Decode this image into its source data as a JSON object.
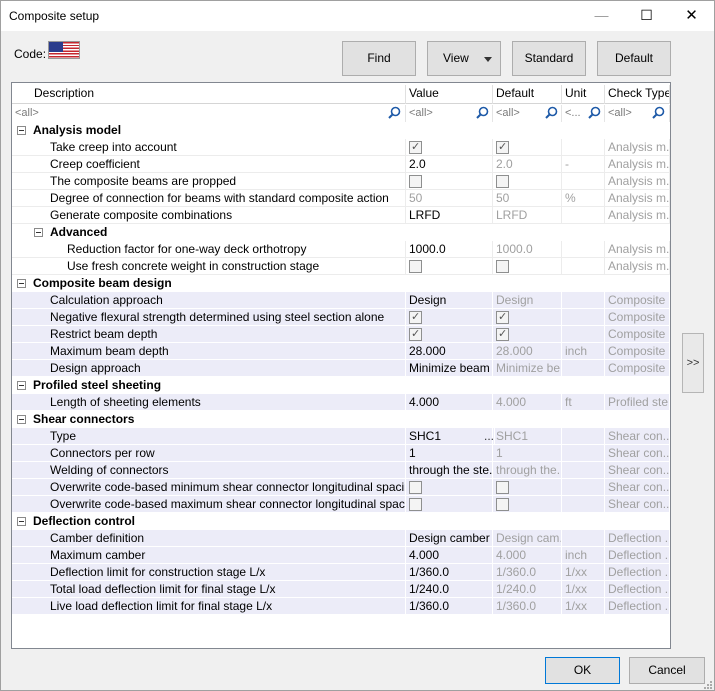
{
  "window": {
    "title": "Composite setup",
    "minimize": "—",
    "maximize": "☐",
    "close": "✕"
  },
  "code": {
    "label": "Code:",
    "flag_icon": "us-flag-icon"
  },
  "toolbar": {
    "find": "Find",
    "view": "View",
    "standard": "Standard",
    "default": "Default"
  },
  "columns": {
    "description": "Description",
    "value": "Value",
    "default": "Default",
    "unit": "Unit",
    "check_type": "Check Type"
  },
  "filter": {
    "description": "<all>",
    "value": "<all>",
    "default": "<all>",
    "unit": "<...",
    "check_type": "<all>"
  },
  "rows": [
    {
      "kind": "section",
      "label": "Analysis model"
    },
    {
      "kind": "prop",
      "tint": false,
      "label": "Take creep into account",
      "value": "",
      "default": "",
      "unit": "",
      "check": "Analysis m...",
      "vcb": true,
      "vchk": true,
      "dcb": true,
      "dchk": true
    },
    {
      "kind": "prop",
      "tint": false,
      "label": "Creep coefficient",
      "value": "2.0",
      "default": "2.0",
      "unit": "-",
      "check": "Analysis m..."
    },
    {
      "kind": "prop",
      "tint": false,
      "label": "The composite beams are propped",
      "value": "",
      "default": "",
      "unit": "",
      "check": "Analysis m...",
      "vcb": true,
      "vchk": false,
      "dcb": true,
      "dchk": false
    },
    {
      "kind": "prop",
      "tint": false,
      "label": "Degree of connection for beams with standard composite action",
      "value": "50",
      "default": "50",
      "unit": "%",
      "check": "Analysis m...",
      "vgray": true
    },
    {
      "kind": "prop",
      "tint": false,
      "label": "Generate composite combinations",
      "value": "LRFD",
      "default": "LRFD",
      "unit": "",
      "check": "Analysis m..."
    },
    {
      "kind": "subsection",
      "label": "Advanced"
    },
    {
      "kind": "prop",
      "tint": false,
      "indent": true,
      "label": "Reduction factor for one-way deck orthotropy",
      "value": "1000.0",
      "default": "1000.0",
      "unit": "",
      "check": "Analysis m..."
    },
    {
      "kind": "prop",
      "tint": false,
      "indent": true,
      "label": "Use fresh concrete weight in construction stage",
      "value": "",
      "default": "",
      "unit": "",
      "check": "Analysis m...",
      "vcb": true,
      "vchk": false,
      "dcb": true,
      "dchk": false
    },
    {
      "kind": "section",
      "label": "Composite beam design"
    },
    {
      "kind": "prop",
      "tint": true,
      "label": "Calculation approach",
      "value": "Design",
      "default": "Design",
      "unit": "",
      "check": "Composite ..."
    },
    {
      "kind": "prop",
      "tint": true,
      "label": "Negative flexural strength determined using steel section alone",
      "value": "",
      "default": "",
      "unit": "",
      "check": "Composite ...",
      "vcb": true,
      "vchk": true,
      "dcb": true,
      "dchk": true
    },
    {
      "kind": "prop",
      "tint": true,
      "label": "Restrict beam depth",
      "value": "",
      "default": "",
      "unit": "",
      "check": "Composite ...",
      "vcb": true,
      "vchk": true,
      "dcb": true,
      "dchk": true
    },
    {
      "kind": "prop",
      "tint": true,
      "label": "Maximum beam depth",
      "value": "28.000",
      "default": "28.000",
      "unit": "inch",
      "check": "Composite ..."
    },
    {
      "kind": "prop",
      "tint": true,
      "label": "Design approach",
      "value": "Minimize beam ...",
      "default": "Minimize be...",
      "unit": "",
      "check": "Composite ..."
    },
    {
      "kind": "section",
      "label": "Profiled steel sheeting"
    },
    {
      "kind": "prop",
      "tint": true,
      "label": "Length of sheeting elements",
      "value": "4.000",
      "default": "4.000",
      "unit": "ft",
      "check": "Profiled ste..."
    },
    {
      "kind": "section",
      "label": "Shear connectors"
    },
    {
      "kind": "prop",
      "tint": true,
      "label": "Type",
      "value": "SHC1",
      "default": "SHC1",
      "unit": "",
      "check": "Shear con...",
      "dots": "..."
    },
    {
      "kind": "prop",
      "tint": true,
      "label": "Connectors per row",
      "value": "1",
      "default": "1",
      "unit": "",
      "check": "Shear con..."
    },
    {
      "kind": "prop",
      "tint": true,
      "label": "Welding of connectors",
      "value": "through the ste...",
      "default": "through the...",
      "unit": "",
      "check": "Shear con..."
    },
    {
      "kind": "prop",
      "tint": true,
      "label": "Overwrite code-based minimum shear connector longitudinal spacing req...",
      "value": "",
      "default": "",
      "unit": "",
      "check": "Shear con...",
      "vcb": true,
      "vchk": false,
      "dcb": true,
      "dchk": false
    },
    {
      "kind": "prop",
      "tint": true,
      "label": "Overwrite code-based maximum shear connector longitudinal spacing req...",
      "value": "",
      "default": "",
      "unit": "",
      "check": "Shear con...",
      "vcb": true,
      "vchk": false,
      "dcb": true,
      "dchk": false
    },
    {
      "kind": "section",
      "label": "Deflection control"
    },
    {
      "kind": "prop",
      "tint": true,
      "label": "Camber definition",
      "value": "Design camber",
      "default": "Design cam...",
      "unit": "",
      "check": "Deflection ..."
    },
    {
      "kind": "prop",
      "tint": true,
      "label": "Maximum camber",
      "value": "4.000",
      "default": "4.000",
      "unit": "inch",
      "check": "Deflection ..."
    },
    {
      "kind": "prop",
      "tint": true,
      "label": "Deflection limit for construction stage L/x",
      "value": "1/360.0",
      "default": "1/360.0",
      "unit": "1/xx",
      "check": "Deflection ..."
    },
    {
      "kind": "prop",
      "tint": true,
      "label": "Total load deflection limit for final stage L/x",
      "value": "1/240.0",
      "default": "1/240.0",
      "unit": "1/xx",
      "check": "Deflection ..."
    },
    {
      "kind": "prop",
      "tint": true,
      "label": "Live load deflection limit for final stage L/x",
      "value": "1/360.0",
      "default": "1/360.0",
      "unit": "1/xx",
      "check": "Deflection ..."
    }
  ],
  "side_button": ">>",
  "footer": {
    "ok": "OK",
    "cancel": "Cancel"
  }
}
